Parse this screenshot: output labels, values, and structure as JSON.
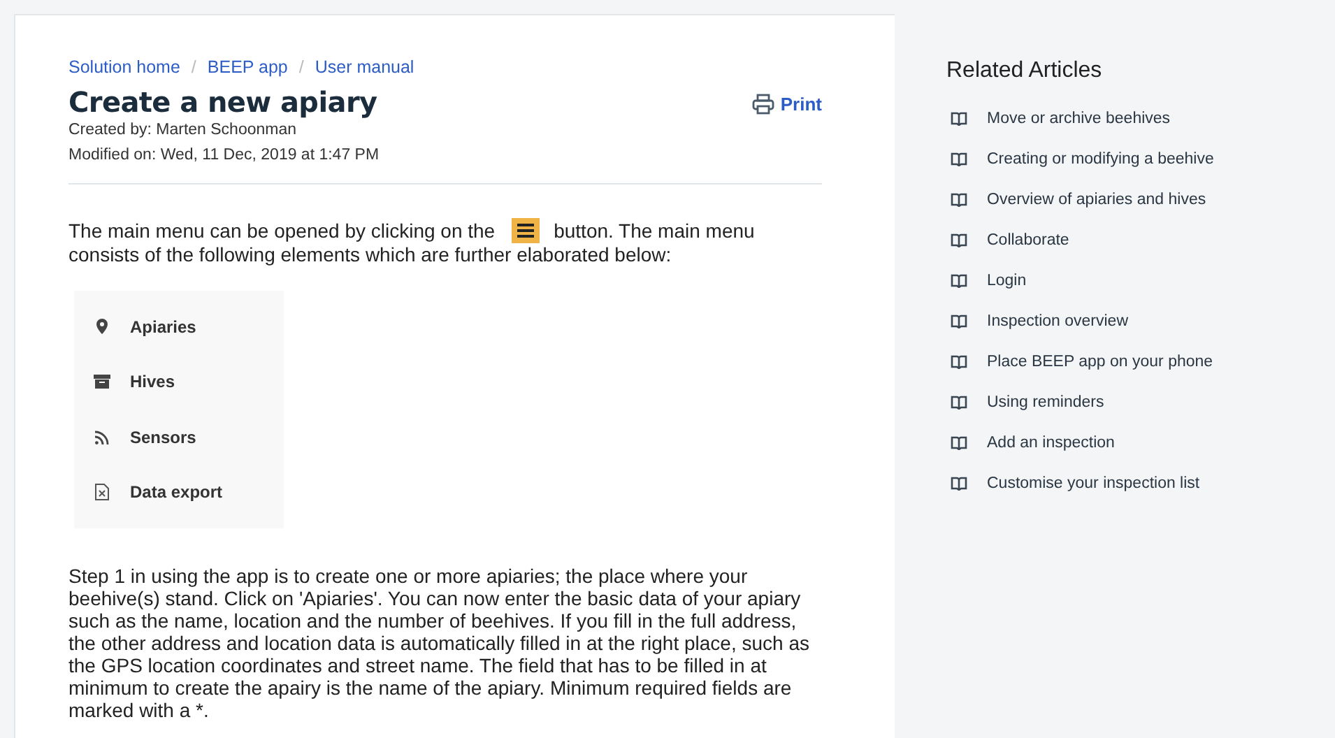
{
  "breadcrumb": [
    {
      "kind": "link",
      "text": "Solution home"
    },
    {
      "kind": "separator",
      "text": "/"
    },
    {
      "kind": "link",
      "text": "BEEP app"
    },
    {
      "kind": "separator",
      "text": "/"
    },
    {
      "kind": "link",
      "text": "User manual"
    }
  ],
  "article": {
    "title": "Create a new apiary",
    "print_label": "Print",
    "created_by": "Created by: Marten Schoonman",
    "modified_on": "Modified on: Wed, 11 Dec, 2019 at 1:47 PM",
    "intro_before": "The main menu can be opened by clicking on the",
    "intro_after": "button. The main menu",
    "intro_line2": "consists of the following elements which are further elaborated below:",
    "menu_items": [
      {
        "kind": "pin",
        "label": "Apiaries"
      },
      {
        "kind": "box",
        "label": "Hives"
      },
      {
        "kind": "feed",
        "label": "Sensors"
      },
      {
        "kind": "file",
        "label": "Data export"
      }
    ],
    "step_text": "Step 1 in using the app is to create one or more apiaries; the place where your beehive(s) stand. Click on 'Apiaries'. You can now enter the basic data of your apiary such as the name, location and the number of beehives. If you fill in the full address, the other address and location data is automatically filled in at the right place, such as the GPS location coordinates and street name. The field that has to be filled in at minimum to create the apairy is the name of the apiary. Minimum required fields are marked with a *."
  },
  "related": {
    "title": "Related Articles",
    "items": [
      "Move or archive beehives",
      "Creating or modifying a beehive",
      "Overview of apiaries and hives",
      "Collaborate",
      "Login",
      "Inspection overview",
      "Place BEEP app on your phone",
      "Using reminders",
      "Add an inspection",
      "Customise your inspection list"
    ]
  }
}
